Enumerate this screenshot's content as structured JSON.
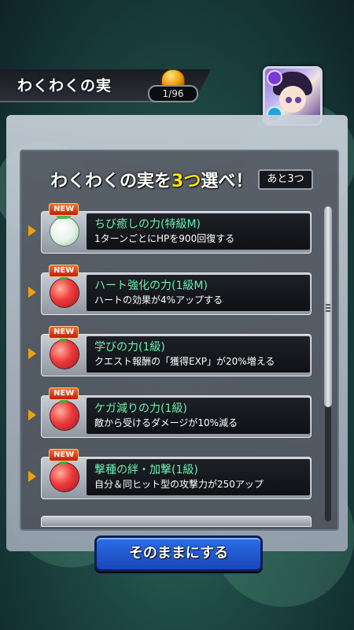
{
  "header": {
    "title": "わくわくの実",
    "counter": "1/96"
  },
  "prompt": {
    "before": "わくわくの実を",
    "highlight": "3つ",
    "after": "選べ！",
    "remaining": "あと3つ"
  },
  "items": [
    {
      "badge": "NEW",
      "name": "ちび癒しの力(特級M)",
      "desc": "1ターンごとにHPを900回復する",
      "fruit": "white-fruit-icon"
    },
    {
      "badge": "NEW",
      "name": "ハート強化の力(1級M)",
      "desc": "ハートの効果が4%アップする",
      "fruit": "red-fruit-icon"
    },
    {
      "badge": "NEW",
      "name": "学びの力(1級)",
      "desc": "クエスト報酬の「獲得EXP」が20%増える",
      "fruit": "red-fruit-icon"
    },
    {
      "badge": "NEW",
      "name": "ケガ減りの力(1級)",
      "desc": "敵から受けるダメージが10%減る",
      "fruit": "red-fruit-icon"
    },
    {
      "badge": "NEW",
      "name": "撃種の絆・加撃(1級)",
      "desc": "自分＆同ヒット型の攻撃力が250アップ",
      "fruit": "red-fruit-icon"
    }
  ],
  "action": {
    "label": "そのままにする"
  },
  "colors": {
    "highlight": "#ffe600",
    "item_name": "#6bf0b0",
    "button": "#2a6ee8",
    "new_badge": "#e0400f"
  }
}
